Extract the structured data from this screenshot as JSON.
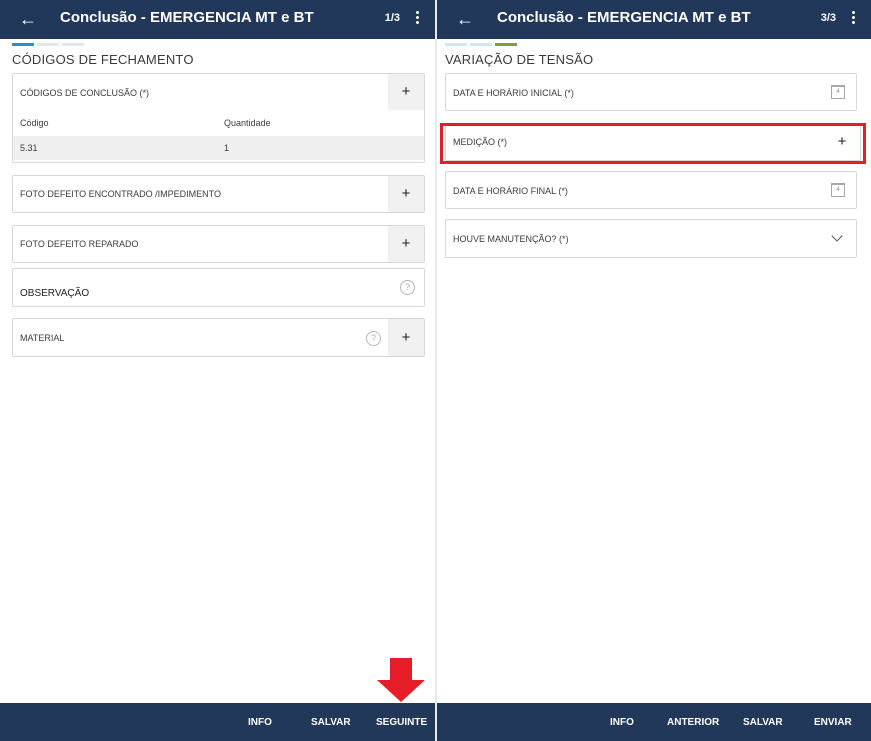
{
  "colors": {
    "appbar": "#22385a",
    "accent_blue": "#2a8fd1",
    "accent_green": "#7fa13c",
    "highlight_red": "#e41d27"
  },
  "left": {
    "appbar": {
      "back_icon": "arrow-left-icon",
      "title": "Conclusão - EMERGENCIA MT e BT",
      "page": "1/3",
      "menu_icon": "kebab-icon"
    },
    "section_title": "CÓDIGOS DE FECHAMENTO",
    "codigos": {
      "label": "CÓDIGOS DE CONCLUSÃO (*)",
      "add": "+",
      "columns": [
        "Código",
        "Quantidade"
      ],
      "rows": [
        {
          "codigo": "5.31",
          "quantidade": "1"
        }
      ]
    },
    "foto_encontrado": {
      "label": "FOTO DEFEITO ENCONTRADO /IMPEDIMENTO",
      "add": "+"
    },
    "foto_reparado": {
      "label": "FOTO DEFEITO REPARADO",
      "add": "+"
    },
    "observacao": {
      "label": "OBSERVAÇÃO",
      "help": "?"
    },
    "material": {
      "label": "MATERIAL",
      "help": "?",
      "add": "+"
    },
    "bottom": {
      "info": "INFO",
      "salvar": "SALVAR",
      "seguinte": "SEGUINTE"
    }
  },
  "right": {
    "appbar": {
      "back_icon": "arrow-left-icon",
      "title": "Conclusão - EMERGENCIA MT e BT",
      "page": "3/3",
      "menu_icon": "kebab-icon"
    },
    "section_title": "VARIAÇÃO DE TENSÃO",
    "data_inicial": {
      "label": "DATA E HORÁRIO INICIAL (*)",
      "cal_day": "4"
    },
    "medicao": {
      "label": "MEDIÇÃO (*)",
      "add": "+"
    },
    "data_final": {
      "label": "DATA E HORÁRIO FINAL (*)",
      "cal_day": "4"
    },
    "manutencao": {
      "label": "HOUVE MANUTENÇÃO? (*)"
    },
    "bottom": {
      "info": "INFO",
      "anterior": "ANTERIOR",
      "salvar": "SALVAR",
      "enviar": "ENVIAR"
    }
  }
}
